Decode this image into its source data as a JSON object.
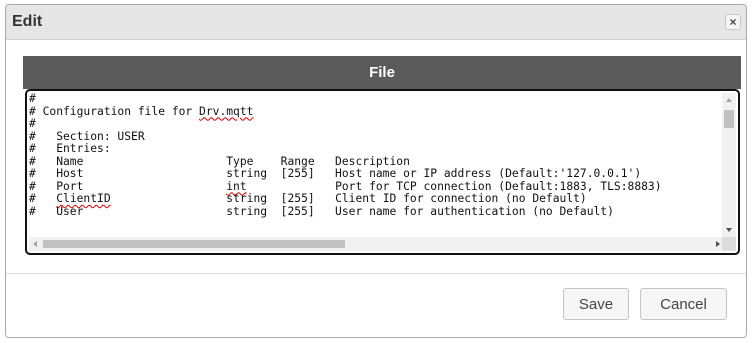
{
  "dialog": {
    "title": "Edit",
    "close_symbol": "×",
    "close_icon": "close-icon"
  },
  "panel": {
    "header": "File"
  },
  "editor": {
    "lines": [
      [
        {
          "t": "#"
        }
      ],
      [
        {
          "t": "# Configuration file for "
        },
        {
          "t": "Drv.mqtt",
          "u": true
        }
      ],
      [
        {
          "t": "#"
        }
      ],
      [
        {
          "t": "#   Section: USER"
        }
      ],
      [
        {
          "t": "#   Entries:"
        }
      ],
      [
        {
          "t": "#   Name                     Type    Range   Description"
        }
      ],
      [
        {
          "t": "#   Host                     string  [255]   Host name or IP address (Default:'127.0.0.1')"
        }
      ],
      [
        {
          "t": "#   Port                     "
        },
        {
          "t": "int",
          "u": true
        },
        {
          "t": "             Port for TCP connection (Default:1883, TLS:8883)"
        }
      ],
      [
        {
          "t": "#   "
        },
        {
          "t": "ClientID",
          "u": true
        },
        {
          "t": "                 string  [255]   Client ID for connection (no Default)"
        }
      ],
      [
        {
          "t": "#   User                     string  [255]   User name for authentication (no Default)"
        }
      ]
    ]
  },
  "footer": {
    "save_label": "Save",
    "cancel_label": "Cancel"
  }
}
